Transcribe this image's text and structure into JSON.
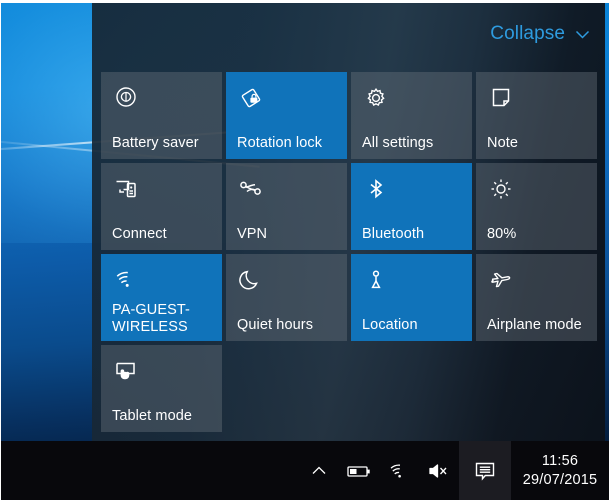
{
  "action_center": {
    "collapse_label": "Collapse",
    "collapse_icon": "chevron-down-icon",
    "tiles": [
      {
        "label": "Battery saver",
        "icon": "battery-saver-icon",
        "active": false
      },
      {
        "label": "Rotation lock",
        "icon": "rotation-lock-icon",
        "active": true
      },
      {
        "label": "All settings",
        "icon": "gear-icon",
        "active": false
      },
      {
        "label": "Note",
        "icon": "note-icon",
        "active": false
      },
      {
        "label": "Connect",
        "icon": "connect-icon",
        "active": false
      },
      {
        "label": "VPN",
        "icon": "vpn-icon",
        "active": false
      },
      {
        "label": "Bluetooth",
        "icon": "bluetooth-icon",
        "active": true
      },
      {
        "label": "80%",
        "icon": "brightness-icon",
        "active": false
      },
      {
        "label": "PA-GUEST-WIRELESS",
        "icon": "wifi-icon",
        "active": true
      },
      {
        "label": "Quiet hours",
        "icon": "moon-icon",
        "active": false
      },
      {
        "label": "Location",
        "icon": "location-icon",
        "active": true
      },
      {
        "label": "Airplane mode",
        "icon": "airplane-icon",
        "active": false
      },
      {
        "label": "Tablet mode",
        "icon": "tablet-mode-icon",
        "active": false
      }
    ]
  },
  "taskbar": {
    "tray_icons": [
      {
        "name": "show-hidden-icons-chevron-icon"
      },
      {
        "name": "battery-icon"
      },
      {
        "name": "wifi-icon"
      },
      {
        "name": "volume-muted-icon"
      }
    ],
    "action_center_icon": "action-center-icon",
    "clock": {
      "time": "11:56",
      "date": "29/07/2015"
    }
  },
  "colors": {
    "accent_blue": "#1073ba",
    "link_blue": "#2e9bdf",
    "tile_inactive": "rgba(104,114,124,.42)",
    "taskbar": "#08080c"
  }
}
